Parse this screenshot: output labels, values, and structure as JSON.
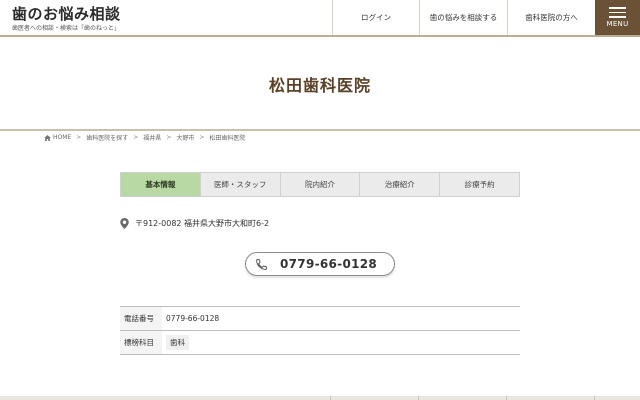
{
  "header": {
    "logo_title": "歯のお悩み相談",
    "logo_tagline": "歯医者への相談・検索は「歯のねっと」",
    "nav": {
      "login": "ログイン",
      "consult": "歯の悩みを相談する",
      "dentist": "歯科医院の方へ"
    },
    "menu_label": "MENU",
    "menu_color": "#6b5135"
  },
  "page": {
    "title": "松田歯科医院"
  },
  "breadcrumb": [
    "HOME",
    "歯科医院を探す",
    "福井県",
    "大野市",
    "松田歯科医院"
  ],
  "tabs": [
    {
      "label": "基本情報",
      "active": true
    },
    {
      "label": "医師・スタッフ",
      "active": false
    },
    {
      "label": "院内紹介",
      "active": false
    },
    {
      "label": "治療紹介",
      "active": false
    },
    {
      "label": "診療予約",
      "active": false
    }
  ],
  "address": {
    "icon": "map-pin-icon",
    "text": "〒912-0082  福井県大野市大和町6-2"
  },
  "phone_button": {
    "icon": "phone-icon",
    "number": "0779-66-0128"
  },
  "info": {
    "phone_label": "電話番号",
    "phone_value": "0779-66-0128",
    "dept_label": "標榜科目",
    "dept_value": "歯科"
  },
  "colors": {
    "accent_brown": "#6b5135",
    "active_tab": "#b8d9a4",
    "title_brown": "#5a4128"
  }
}
